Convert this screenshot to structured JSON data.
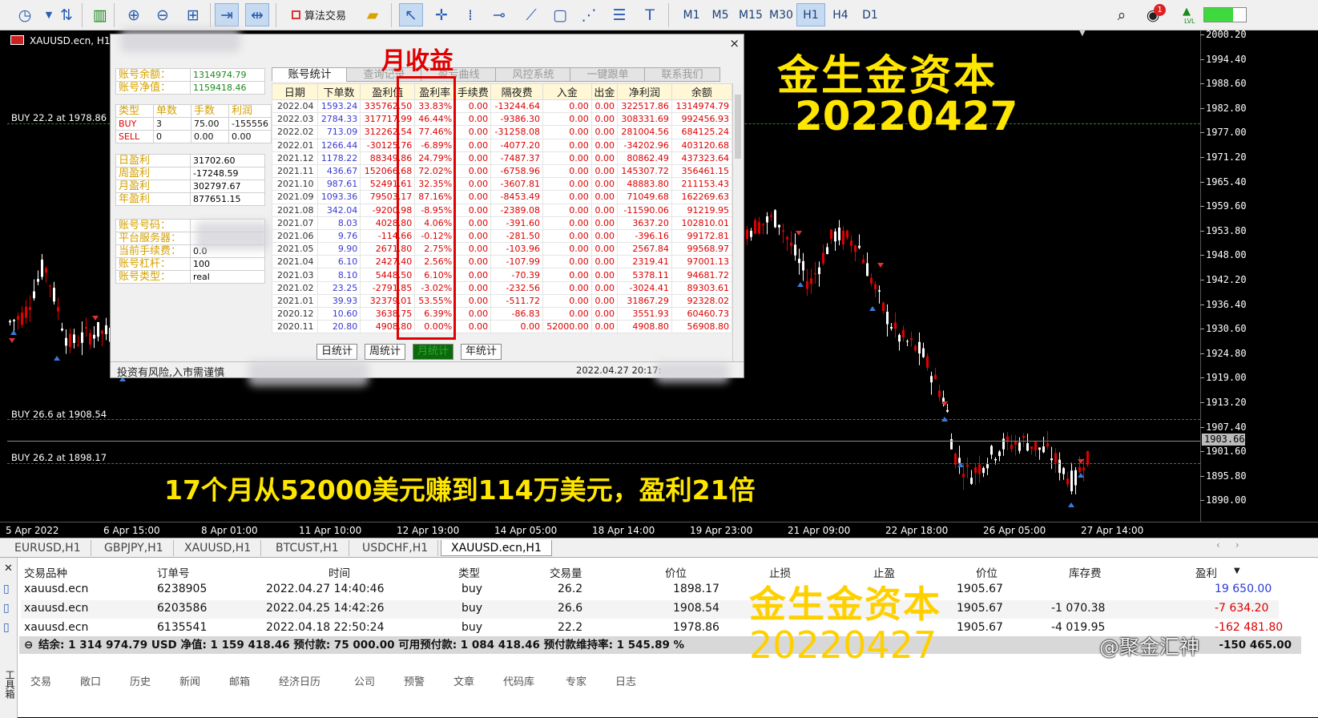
{
  "toolbar": {
    "algo_trading": "算法交易",
    "timeframes": [
      "M1",
      "M5",
      "M15",
      "M30",
      "H1",
      "H4",
      "D1"
    ],
    "active_timeframe": "H1",
    "notify_count": "1",
    "lvl": "LVL"
  },
  "chart": {
    "symbol_title": "XAUUSD.ecn, H1:",
    "price_labels": [
      "2000.20",
      "1994.40",
      "1988.60",
      "1982.80",
      "1977.00",
      "1971.20",
      "1965.40",
      "1959.60",
      "1953.80",
      "1948.00",
      "1942.20",
      "1936.40",
      "1930.60",
      "1924.80",
      "1919.00",
      "1913.20",
      "1907.40",
      "1901.60",
      "1895.80",
      "1890.00"
    ],
    "current_price": "1903.66",
    "time_labels": [
      "5 Apr 2022",
      "6 Apr 15:00",
      "8 Apr 01:00",
      "11 Apr 10:00",
      "12 Apr 19:00",
      "14 Apr 05:00",
      "18 Apr 14:00",
      "19 Apr 23:00",
      "21 Apr 09:00",
      "22 Apr 18:00",
      "26 Apr 05:00",
      "27 Apr 14:00"
    ],
    "buy_lines": [
      "BUY 22.2 at 1978.86",
      "BUY 26.6 at 1908.54",
      "BUY 26.2 at 1898.17"
    ],
    "overlay_title": "金生金资本",
    "overlay_date": "20220427",
    "overlay_bottom": "17个月从52000美元赚到114万美元，盈利21倍"
  },
  "panel": {
    "close": "×",
    "balance_label": "账号余额：",
    "balance": "1314974.79",
    "equity_label": "账号净值：",
    "equity": "1159418.46",
    "pos_headers": [
      "类型",
      "单数",
      "手数",
      "利润"
    ],
    "pos_rows": [
      [
        "BUY",
        "3",
        "75.00",
        "-155556"
      ],
      [
        "SELL",
        "0",
        "0.00",
        "0.00"
      ]
    ],
    "period_rows": [
      [
        "日盈利",
        "31702.60"
      ],
      [
        "周盈利",
        "-17248.59"
      ],
      [
        "月盈利",
        "302797.67"
      ],
      [
        "年盈利",
        "877651.15"
      ]
    ],
    "acct_rows": [
      [
        "账号号码：",
        ""
      ],
      [
        "平台服务器：",
        ""
      ],
      [
        "当前手续费：",
        "0.0"
      ],
      [
        "账号杠杆：",
        "100"
      ],
      [
        "账号类型：",
        "real"
      ]
    ],
    "tabs": [
      "账号统计",
      "查询记录",
      "盈亏曲线",
      "风控系统",
      "一键跟单",
      "联系我们"
    ],
    "table_headers": [
      "日期",
      "下单数",
      "盈利值",
      "盈利率",
      "手续费",
      "隔夜费",
      "入金",
      "出金",
      "净利润",
      "余额"
    ],
    "rows": [
      [
        "2022.04",
        "1593.24",
        "335762.50",
        "33.83%",
        "0.00",
        "-13244.64",
        "0.00",
        "0.00",
        "322517.86",
        "1314974.79"
      ],
      [
        "2022.03",
        "2784.33",
        "317717.99",
        "46.44%",
        "0.00",
        "-9386.30",
        "0.00",
        "0.00",
        "308331.69",
        "992456.93"
      ],
      [
        "2022.02",
        "713.09",
        "312262.54",
        "77.46%",
        "0.00",
        "-31258.08",
        "0.00",
        "0.00",
        "281004.56",
        "684125.24"
      ],
      [
        "2022.01",
        "1266.44",
        "-30125.76",
        "-6.89%",
        "0.00",
        "-4077.20",
        "0.00",
        "0.00",
        "-34202.96",
        "403120.68"
      ],
      [
        "2021.12",
        "1178.22",
        "88349.86",
        "24.79%",
        "0.00",
        "-7487.37",
        "0.00",
        "0.00",
        "80862.49",
        "437323.64"
      ],
      [
        "2021.11",
        "436.67",
        "152066.68",
        "72.02%",
        "0.00",
        "-6758.96",
        "0.00",
        "0.00",
        "145307.72",
        "356461.15"
      ],
      [
        "2021.10",
        "987.61",
        "52491.61",
        "32.35%",
        "0.00",
        "-3607.81",
        "0.00",
        "0.00",
        "48883.80",
        "211153.43"
      ],
      [
        "2021.09",
        "1093.36",
        "79503.17",
        "87.16%",
        "0.00",
        "-8453.49",
        "0.00",
        "0.00",
        "71049.68",
        "162269.63"
      ],
      [
        "2021.08",
        "342.04",
        "-9200.98",
        "-8.95%",
        "0.00",
        "-2389.08",
        "0.00",
        "0.00",
        "-11590.06",
        "91219.95"
      ],
      [
        "2021.07",
        "8.03",
        "4028.80",
        "4.06%",
        "0.00",
        "-391.60",
        "0.00",
        "0.00",
        "3637.20",
        "102810.01"
      ],
      [
        "2021.06",
        "9.76",
        "-114.66",
        "-0.12%",
        "0.00",
        "-281.50",
        "0.00",
        "0.00",
        "-396.16",
        "99172.81"
      ],
      [
        "2021.05",
        "9.90",
        "2671.80",
        "2.75%",
        "0.00",
        "-103.96",
        "0.00",
        "0.00",
        "2567.84",
        "99568.97"
      ],
      [
        "2021.04",
        "6.10",
        "2427.40",
        "2.56%",
        "0.00",
        "-107.99",
        "0.00",
        "0.00",
        "2319.41",
        "97001.13"
      ],
      [
        "2021.03",
        "8.10",
        "5448.50",
        "6.10%",
        "0.00",
        "-70.39",
        "0.00",
        "0.00",
        "5378.11",
        "94681.72"
      ],
      [
        "2021.02",
        "23.25",
        "-2791.85",
        "-3.02%",
        "0.00",
        "-232.56",
        "0.00",
        "0.00",
        "-3024.41",
        "89303.61"
      ],
      [
        "2021.01",
        "39.93",
        "32379.01",
        "53.55%",
        "0.00",
        "-511.72",
        "0.00",
        "0.00",
        "31867.29",
        "92328.02"
      ],
      [
        "2020.12",
        "10.60",
        "3638.75",
        "6.39%",
        "0.00",
        "-86.83",
        "0.00",
        "0.00",
        "3551.93",
        "60460.73"
      ],
      [
        "2020.11",
        "20.80",
        "4908.80",
        "0.00%",
        "0.00",
        "0.00",
        "52000.00",
        "0.00",
        "4908.80",
        "56908.80"
      ]
    ],
    "annotation": "月收益",
    "buttons": [
      "日统计",
      "周统计",
      "月统计",
      "年统计"
    ],
    "status_left": "投资有风险,入市需谨慎",
    "status_right": "2022.04.27 20:17:"
  },
  "symbol_tabs": [
    "EURUSD,H1",
    "GBPJPY,H1",
    "XAUUSD,H1",
    "BTCUST,H1",
    "USDCHF,H1",
    "XAUUSD.ecn,H1"
  ],
  "terminal": {
    "side_label": "工具箱",
    "headers": [
      "交易品种",
      "订单号",
      "时间",
      "类型",
      "交易量",
      "价位",
      "止损",
      "止盈",
      "价位",
      "库存费",
      "盈利"
    ],
    "rows": [
      [
        "xauusd.ecn",
        "6238905",
        "2022.04.27 14:40:46",
        "buy",
        "26.2",
        "1898.17",
        "",
        "",
        "1905.67",
        "",
        "19 650.00"
      ],
      [
        "xauusd.ecn",
        "6203586",
        "2022.04.25 14:42:26",
        "buy",
        "26.6",
        "1908.54",
        "",
        "",
        "1905.67",
        "-1 070.38",
        "-7 634.20"
      ],
      [
        "xauusd.ecn",
        "6135541",
        "2022.04.18 22:50:24",
        "buy",
        "22.2",
        "1978.86",
        "",
        "",
        "1905.67",
        "-4 019.95",
        "-162 481.80"
      ]
    ],
    "summary": "结余: 1 314 974.79 USD  净值: 1 159 418.46  预付款: 75 000.00  可用预付款: 1 084 418.46  预付款维持率: 1 545.89 %",
    "summary_tail": "-150 465.00",
    "watermark": "@聚金汇神",
    "bottom_tabs": [
      "交易",
      "敞口",
      "历史",
      "新闻",
      "邮箱",
      "经济日历",
      "公司",
      "预警",
      "文章",
      "代码库",
      "专家",
      "日志"
    ]
  },
  "colors": {
    "bull": "#ffffff",
    "bear": "#e00000",
    "grid": "#2a8a2a",
    "overlay": "#ffe600"
  }
}
